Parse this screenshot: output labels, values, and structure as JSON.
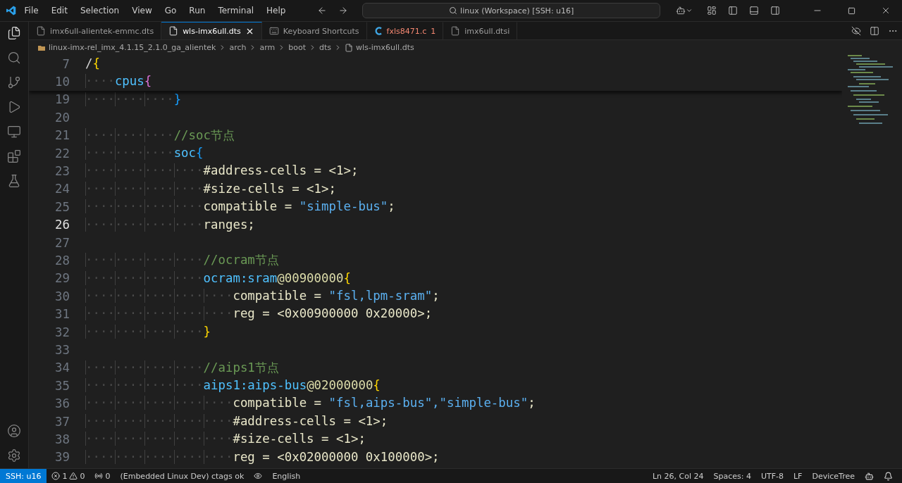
{
  "menu": [
    "File",
    "Edit",
    "Selection",
    "View",
    "Go",
    "Run",
    "Terminal",
    "Help"
  ],
  "command_center": "linux (Workspace) [SSH: u16]",
  "tabs": [
    {
      "label": "imx6ull-alientek-emmc.dts",
      "kind": "file",
      "selected": false
    },
    {
      "label": "wls-imx6ull.dts",
      "kind": "file",
      "selected": true
    },
    {
      "label": "Keyboard Shortcuts",
      "kind": "keyboard",
      "selected": false
    },
    {
      "label": "fxls8471.c",
      "kind": "c",
      "selected": false,
      "badge": "1"
    },
    {
      "label": "imx6ull.dtsi",
      "kind": "file",
      "selected": false
    }
  ],
  "breadcrumbs": [
    "linux-imx-rel_imx_4.1.15_2.1.0_ga_alientek",
    "arch",
    "arm",
    "boot",
    "dts",
    "wls-imx6ull.dts"
  ],
  "sticky_lines": [
    {
      "number": "7",
      "current": false,
      "tokens": [
        {
          "kind": "plain",
          "text": "/"
        },
        {
          "kind": "brace1",
          "text": "{"
        }
      ]
    },
    {
      "number": "10",
      "current": false,
      "tokens": [
        {
          "kind": "space",
          "text": "····"
        },
        {
          "kind": "node",
          "text": "cpus"
        },
        {
          "kind": "brace2",
          "text": "{"
        }
      ]
    }
  ],
  "lines": [
    {
      "number": "19",
      "current": false,
      "tokens": [
        {
          "kind": "space",
          "text": "············"
        },
        {
          "kind": "brace3",
          "text": "}"
        }
      ]
    },
    {
      "number": "20",
      "current": false
    },
    {
      "number": "21",
      "current": false,
      "tokens": [
        {
          "kind": "space",
          "text": "············"
        },
        {
          "kind": "comment",
          "text": "//soc节点"
        }
      ]
    },
    {
      "number": "22",
      "current": false,
      "tokens": [
        {
          "kind": "space",
          "text": "············"
        },
        {
          "kind": "node",
          "text": "soc"
        },
        {
          "kind": "brace3",
          "text": "{"
        }
      ]
    },
    {
      "number": "23",
      "current": false,
      "tokens": [
        {
          "kind": "space",
          "text": "················"
        },
        {
          "kind": "prop",
          "text": "#address-cells = <1>;"
        }
      ]
    },
    {
      "number": "24",
      "current": false,
      "tokens": [
        {
          "kind": "space",
          "text": "················"
        },
        {
          "kind": "prop",
          "text": "#size-cells = <1>;"
        }
      ]
    },
    {
      "number": "25",
      "current": false,
      "tokens": [
        {
          "kind": "space",
          "text": "················"
        },
        {
          "kind": "prop",
          "text": "compatible = "
        },
        {
          "kind": "string",
          "text": "\"simple-bus\""
        },
        {
          "kind": "prop",
          "text": ";"
        }
      ]
    },
    {
      "number": "26",
      "current": true,
      "tokens": [
        {
          "kind": "space",
          "text": "················"
        },
        {
          "kind": "prop",
          "text": "ranges;"
        }
      ]
    },
    {
      "number": "27",
      "current": false
    },
    {
      "number": "28",
      "current": false,
      "tokens": [
        {
          "kind": "space",
          "text": "················"
        },
        {
          "kind": "comment",
          "text": "//ocram节点"
        }
      ]
    },
    {
      "number": "29",
      "current": false,
      "tokens": [
        {
          "kind": "space",
          "text": "················"
        },
        {
          "kind": "node",
          "text": "ocram:sram"
        },
        {
          "kind": "addr",
          "text": "@00900000"
        },
        {
          "kind": "brace1",
          "text": "{"
        }
      ]
    },
    {
      "number": "30",
      "current": false,
      "tokens": [
        {
          "kind": "space",
          "text": "····················"
        },
        {
          "kind": "prop",
          "text": "compatible = "
        },
        {
          "kind": "string",
          "text": "\"fsl,lpm-sram\""
        },
        {
          "kind": "prop",
          "text": ";"
        }
      ]
    },
    {
      "number": "31",
      "current": false,
      "tokens": [
        {
          "kind": "space",
          "text": "····················"
        },
        {
          "kind": "prop",
          "text": "reg = <0x00900000 0x20000>;"
        }
      ]
    },
    {
      "number": "32",
      "current": false,
      "tokens": [
        {
          "kind": "space",
          "text": "················"
        },
        {
          "kind": "brace1",
          "text": "}"
        }
      ]
    },
    {
      "number": "33",
      "current": false
    },
    {
      "number": "34",
      "current": false,
      "tokens": [
        {
          "kind": "space",
          "text": "················"
        },
        {
          "kind": "comment",
          "text": "//aips1节点"
        }
      ]
    },
    {
      "number": "35",
      "current": false,
      "tokens": [
        {
          "kind": "space",
          "text": "················"
        },
        {
          "kind": "node",
          "text": "aips1:aips-bus"
        },
        {
          "kind": "addr",
          "text": "@02000000"
        },
        {
          "kind": "brace1",
          "text": "{"
        }
      ]
    },
    {
      "number": "36",
      "current": false,
      "tokens": [
        {
          "kind": "space",
          "text": "····················"
        },
        {
          "kind": "prop",
          "text": "compatible = "
        },
        {
          "kind": "string",
          "text": "\"fsl,aips-bus\",\"simple-bus\""
        },
        {
          "kind": "prop",
          "text": ";"
        }
      ]
    },
    {
      "number": "37",
      "current": false,
      "tokens": [
        {
          "kind": "space",
          "text": "····················"
        },
        {
          "kind": "prop",
          "text": "#address-cells = <1>;"
        }
      ]
    },
    {
      "number": "38",
      "current": false,
      "tokens": [
        {
          "kind": "space",
          "text": "····················"
        },
        {
          "kind": "prop",
          "text": "#size-cells = <1>;"
        }
      ]
    },
    {
      "number": "39",
      "current": false,
      "tokens": [
        {
          "kind": "space",
          "text": "····················"
        },
        {
          "kind": "prop",
          "text": "reg = <0x02000000 0x100000>;"
        }
      ]
    }
  ],
  "status_left": {
    "remote": "SSH: u16",
    "errors": "1",
    "warnings": "0",
    "ports": "0",
    "task": "(Embedded Linux Dev) ctags ok",
    "language_input": "English"
  },
  "status_right": [
    "Ln 26, Col 24",
    "Spaces: 4",
    "UTF-8",
    "LF",
    "DeviceTree"
  ]
}
